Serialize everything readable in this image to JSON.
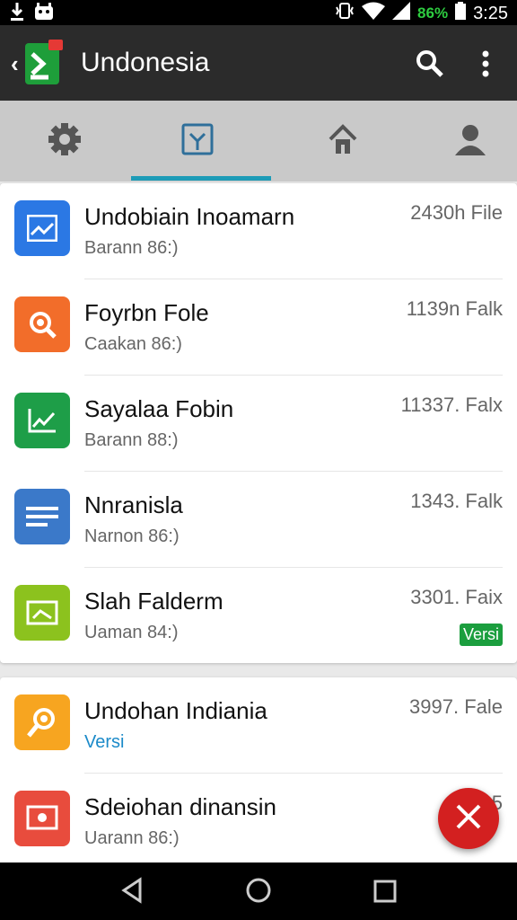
{
  "status_bar": {
    "battery_text": "86%",
    "time": "3:25"
  },
  "app_bar": {
    "title": "Undonesia"
  },
  "tabs": [
    {
      "icon": "gear-icon",
      "selected": false
    },
    {
      "icon": "inbox-icon",
      "selected": true
    },
    {
      "icon": "home-icon",
      "selected": false
    },
    {
      "icon": "person-icon",
      "selected": false
    }
  ],
  "list": {
    "items": [
      {
        "title": "Undobiain Inoamarn",
        "subtitle": "Barann 86:)",
        "meta": "2430h File",
        "icon": "chart-icon",
        "color": "#2b78e4"
      },
      {
        "title": "Foyrbn Fole",
        "subtitle": "Caakan 86:)",
        "meta": "1139n Falk",
        "icon": "search-icon",
        "color": "#f26d2a"
      },
      {
        "title": "Sayalaa Fobin",
        "subtitle": "Barann 88:)",
        "meta": "11337. Falx",
        "icon": "chart-icon",
        "color": "#1e9e48"
      },
      {
        "title": "Nnranisla",
        "subtitle": "Narnon 86:)",
        "meta": "1343. Falk",
        "icon": "document-icon",
        "color": "#3b79c9"
      },
      {
        "title": "Slah Falderm",
        "subtitle": "Uaman 84:)",
        "meta": "3301. Faix",
        "icon": "image-icon",
        "color": "#8cc21e",
        "badge": "Versi"
      }
    ]
  },
  "list2": {
    "items": [
      {
        "title": "Undohan Indiania",
        "subtitle": "Versi",
        "meta": "3997. Fale",
        "icon": "magnifier-icon",
        "color": "#f7a520"
      },
      {
        "title": "Sdeiohan dinansin",
        "subtitle": "Uarann 86:)",
        "meta": "25",
        "icon": "photo-icon",
        "color": "#e84c3d"
      }
    ]
  },
  "fab": {
    "icon": "close-icon"
  },
  "nav_bar": {
    "buttons": [
      "back-icon",
      "home-circle-icon",
      "recents-icon"
    ]
  }
}
